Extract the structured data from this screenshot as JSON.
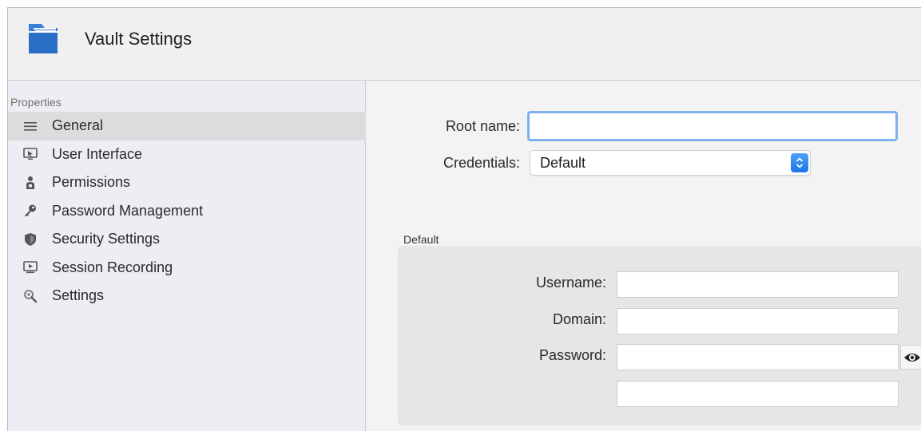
{
  "window": {
    "title": "Vault Settings"
  },
  "sidebar": {
    "heading": "Properties",
    "items": [
      {
        "label": "General",
        "icon": "menu-lines-icon",
        "active": true
      },
      {
        "label": "User Interface",
        "icon": "monitor-cursor-icon",
        "active": false
      },
      {
        "label": "Permissions",
        "icon": "person-lock-icon",
        "active": false
      },
      {
        "label": "Password Management",
        "icon": "key-icon",
        "active": false
      },
      {
        "label": "Security Settings",
        "icon": "shield-icon",
        "active": false
      },
      {
        "label": "Session Recording",
        "icon": "play-screen-icon",
        "active": false
      },
      {
        "label": "Settings",
        "icon": "magnifier-icon",
        "active": false
      }
    ]
  },
  "form": {
    "root_name_label": "Root name:",
    "root_name_value": "",
    "credentials_label": "Credentials:",
    "credentials_value": "Default"
  },
  "group": {
    "title": "Default",
    "username_label": "Username:",
    "username_value": "",
    "domain_label": "Domain:",
    "domain_value": "",
    "password_label": "Password:",
    "password_value": "",
    "extra_value": ""
  },
  "colors": {
    "focus_ring": "#7fb1ea",
    "accent_blue": "#1a73e8",
    "folder_blue": "#2a6fc6",
    "sidebar_bg": "#eceef3",
    "selected_row": "#dcdcde"
  }
}
